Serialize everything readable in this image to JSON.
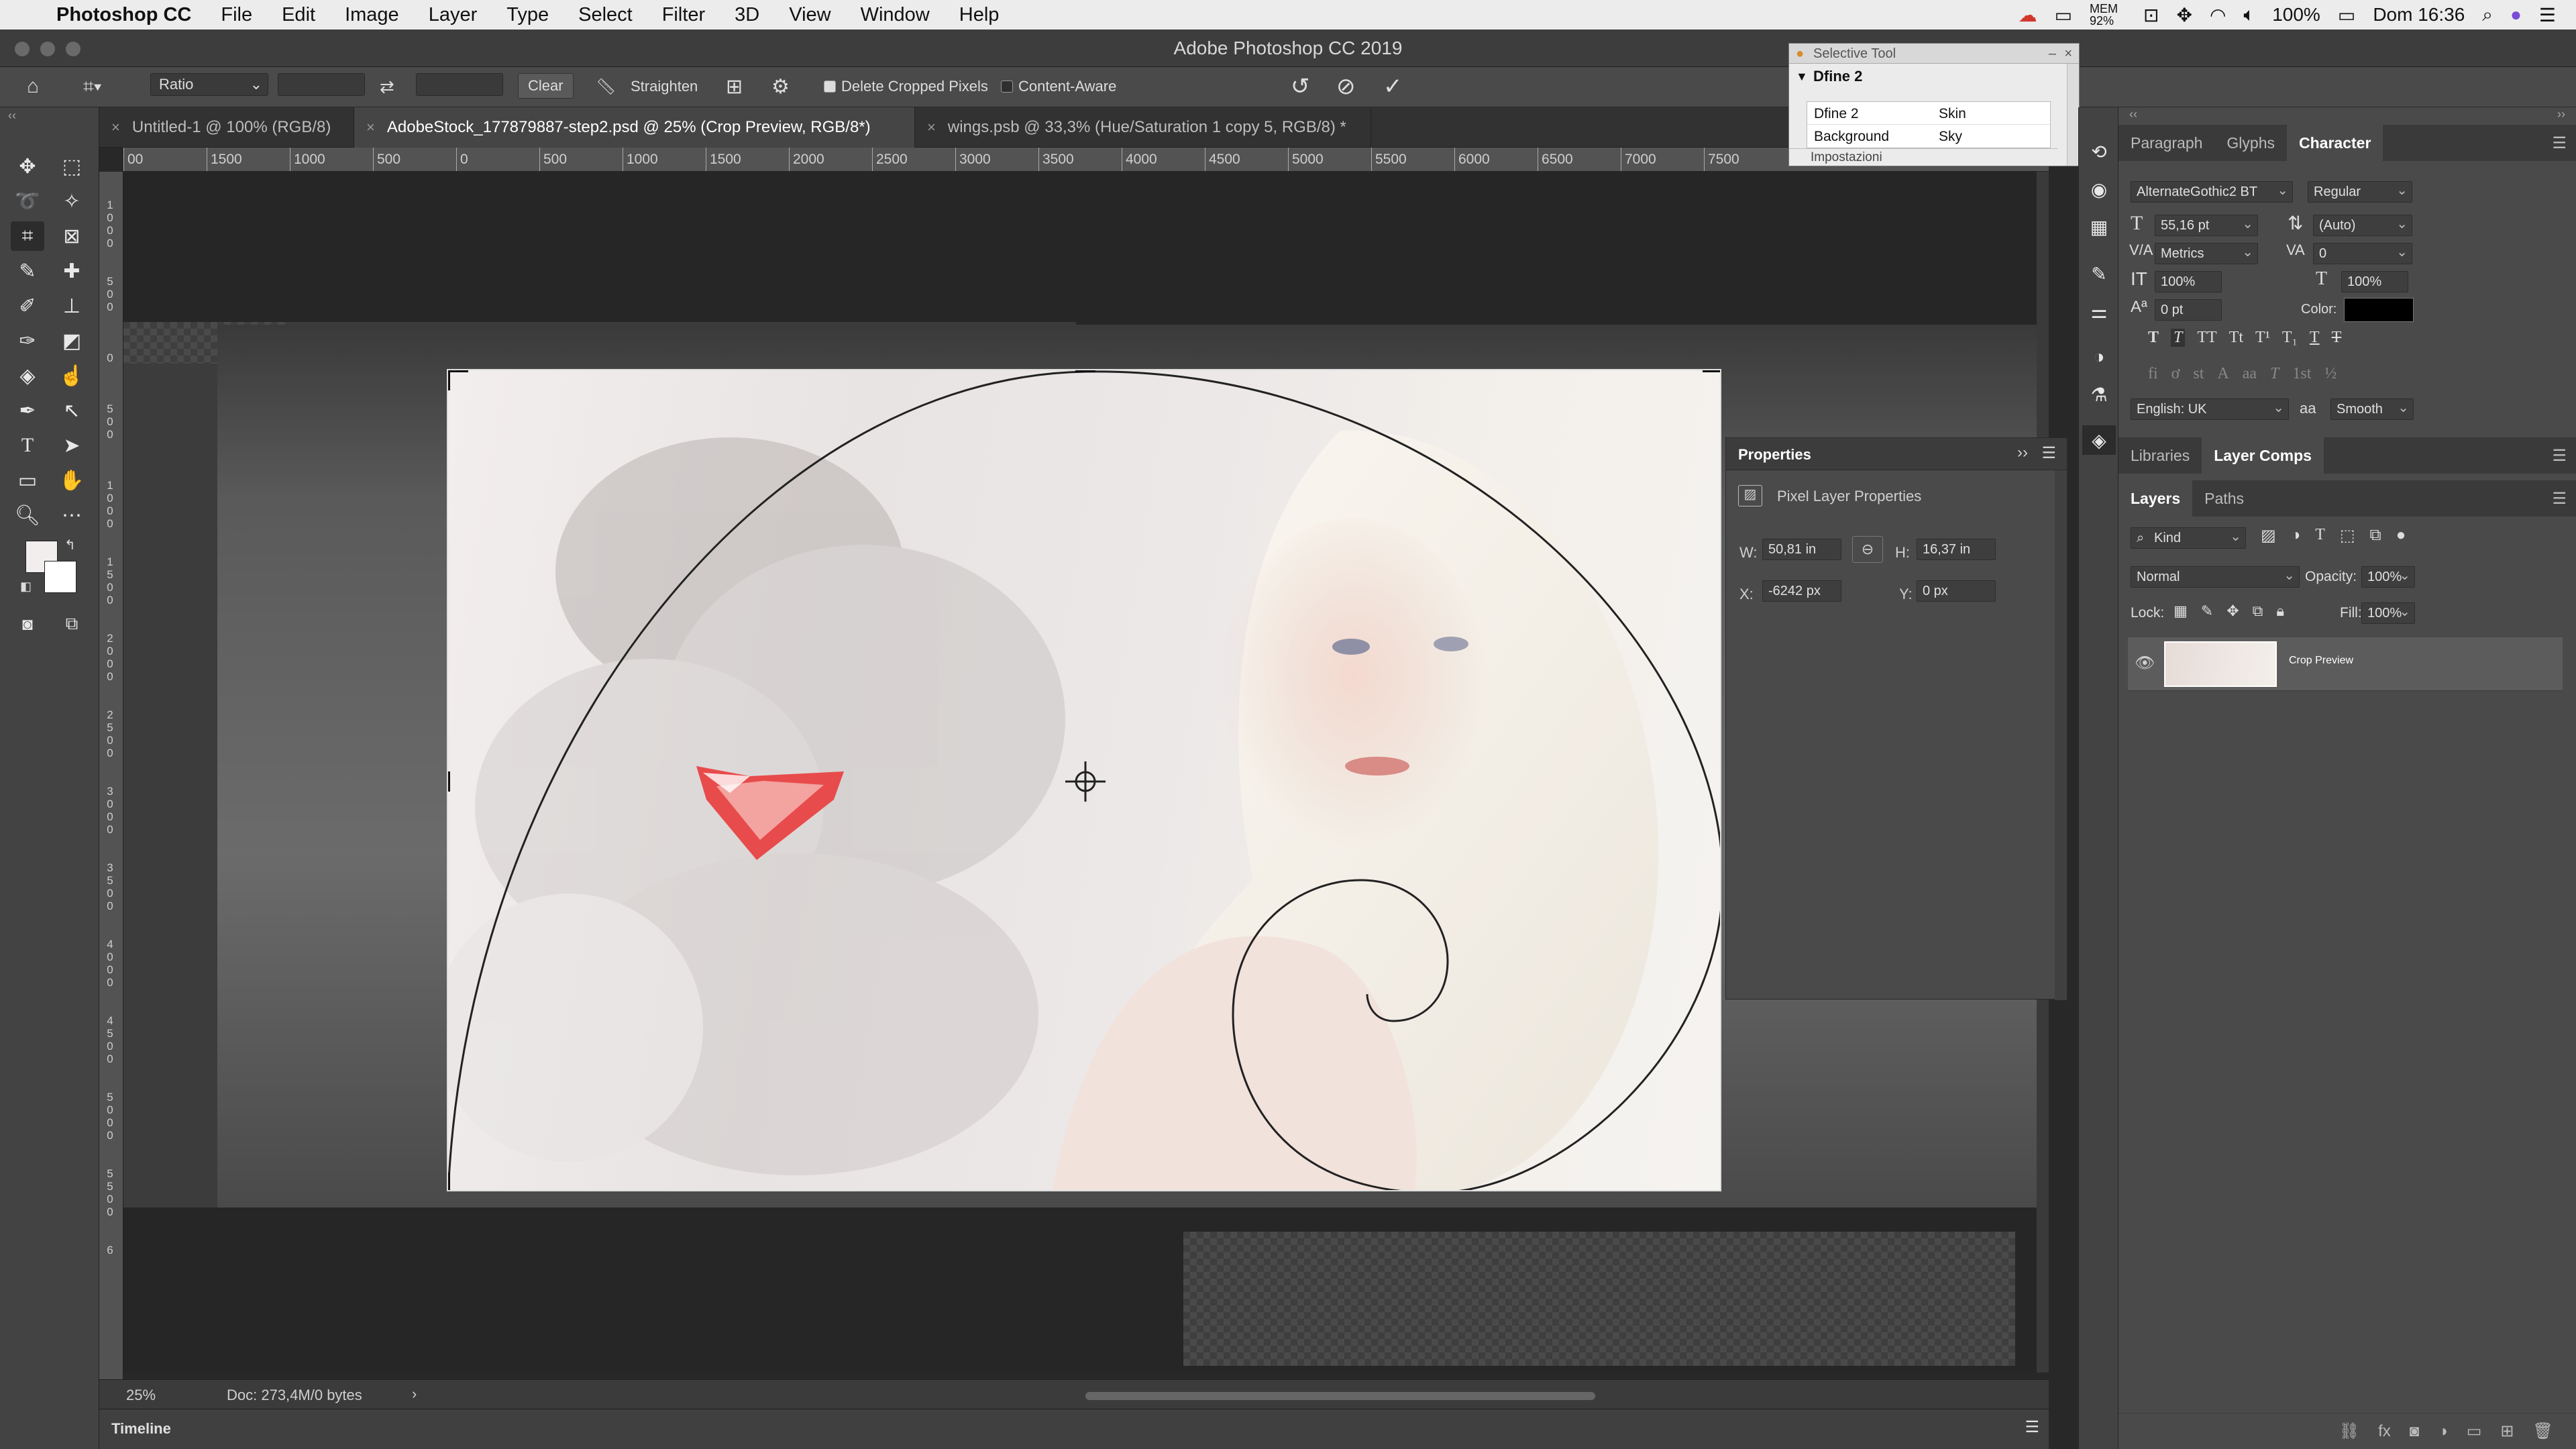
{
  "menubar": {
    "apple": "",
    "app": "Photoshop CC",
    "items": [
      "File",
      "Edit",
      "Image",
      "Layer",
      "Type",
      "Select",
      "Filter",
      "3D",
      "View",
      "Window",
      "Help"
    ],
    "mem": "MEM 92%",
    "battery": "100%",
    "clock": "Dom 16:36"
  },
  "window": {
    "title": "Adobe Photoshop CC 2019"
  },
  "options": {
    "ratio": "Ratio",
    "clear": "Clear",
    "straighten": "Straighten",
    "delete_cropped": "Delete Cropped Pixels",
    "content_aware": "Content-Aware"
  },
  "tabs": [
    {
      "label": "Untitled-1 @ 100% (RGB/8)"
    },
    {
      "label": "AdobeStock_177879887-step2.psd @ 25% (Crop Preview, RGB/8*)"
    },
    {
      "label": "wings.psb @ 33,3% (Hue/Saturation 1 copy 5, RGB/8) *"
    }
  ],
  "ruler_h": [
    "00",
    "1500",
    "1000",
    "500",
    "0",
    "500",
    "1000",
    "1500",
    "2000",
    "2500",
    "3000",
    "3500",
    "4000",
    "4500",
    "5000",
    "5500",
    "6000",
    "6500",
    "7000",
    "7500"
  ],
  "selective": {
    "title": "Selective Tool",
    "header": "Dfine 2",
    "rows": [
      [
        "Dfine 2",
        "Skin"
      ],
      [
        "Background",
        "Sky"
      ]
    ],
    "footer": "Impostazioni"
  },
  "properties": {
    "title": "Properties",
    "section": "Pixel Layer Properties",
    "w_label": "W:",
    "w": "50,81 in",
    "h_label": "H:",
    "h": "16,37 in",
    "x_label": "X:",
    "x": "-6242 px",
    "y_label": "Y:",
    "y": "0 px"
  },
  "character": {
    "tabs": [
      "Paragraph",
      "Glyphs",
      "Character"
    ],
    "font": "AlternateGothic2 BT",
    "style": "Regular",
    "size": "55,16 pt",
    "leading": "(Auto)",
    "kerning": "Metrics",
    "tracking": "0",
    "vscale": "100%",
    "hscale": "100%",
    "baseline": "0 pt",
    "color_label": "Color:",
    "language": "English: UK",
    "aa_label": "aa",
    "antialias": "Smooth",
    "styles": [
      "T",
      "T",
      "TT",
      "Tt",
      "T¹",
      "T₁",
      "T",
      "T"
    ],
    "ot": [
      "fi",
      "ơ",
      "st",
      "A",
      "aa",
      "T",
      "1st",
      "½"
    ]
  },
  "lib_tabs": [
    "Libraries",
    "Layer Comps"
  ],
  "layers": {
    "tabs": [
      "Layers",
      "Paths"
    ],
    "kind": "Kind",
    "blend": "Normal",
    "opacity_label": "Opacity:",
    "opacity": "100%",
    "lock_label": "Lock:",
    "fill_label": "Fill:",
    "fill": "100%",
    "items": [
      {
        "name": "Crop Preview"
      }
    ]
  },
  "status": {
    "zoom": "25%",
    "doc": "Doc: 273,4M/0 bytes"
  },
  "timeline": {
    "label": "Timeline"
  }
}
